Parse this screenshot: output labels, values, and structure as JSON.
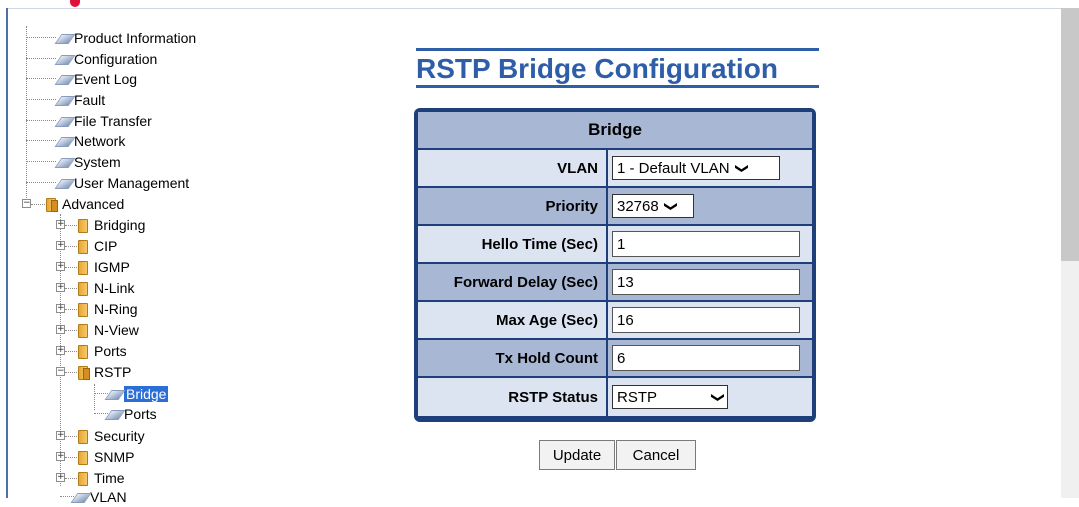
{
  "tree": {
    "items": [
      {
        "label": "Product Information"
      },
      {
        "label": "Configuration"
      },
      {
        "label": "Event Log"
      },
      {
        "label": "Fault"
      },
      {
        "label": "File Transfer"
      },
      {
        "label": "Network"
      },
      {
        "label": "System"
      },
      {
        "label": "User Management"
      },
      {
        "label": "Advanced"
      },
      {
        "label": "Bridging"
      },
      {
        "label": "CIP"
      },
      {
        "label": "IGMP"
      },
      {
        "label": "N-Link"
      },
      {
        "label": "N-Ring"
      },
      {
        "label": "N-View"
      },
      {
        "label": "Ports"
      },
      {
        "label": "RSTP"
      },
      {
        "label": "Bridge"
      },
      {
        "label": "Ports"
      },
      {
        "label": "Security"
      },
      {
        "label": "SNMP"
      },
      {
        "label": "Time"
      },
      {
        "label": "VLAN"
      }
    ]
  },
  "page": {
    "title": "RSTP Bridge Configuration"
  },
  "form": {
    "header": "Bridge",
    "rows": [
      {
        "label": "VLAN",
        "value": "1 - Default VLAN",
        "type": "select"
      },
      {
        "label": "Priority",
        "value": "32768",
        "type": "select"
      },
      {
        "label": "Hello Time (Sec)",
        "value": "1",
        "type": "text"
      },
      {
        "label": "Forward Delay (Sec)",
        "value": "13",
        "type": "text"
      },
      {
        "label": "Max Age (Sec)",
        "value": "16",
        "type": "text"
      },
      {
        "label": "Tx Hold Count",
        "value": "6",
        "type": "text"
      },
      {
        "label": "RSTP Status",
        "value": "RSTP",
        "type": "select"
      }
    ]
  },
  "buttons": {
    "update": "Update",
    "cancel": "Cancel"
  },
  "colors": {
    "accent": "#2f5ea8",
    "panel_border": "#1f3f7a",
    "row_dark": "#a8b8d4",
    "row_light": "#dce4f2",
    "selected": "#2b6fd6"
  }
}
